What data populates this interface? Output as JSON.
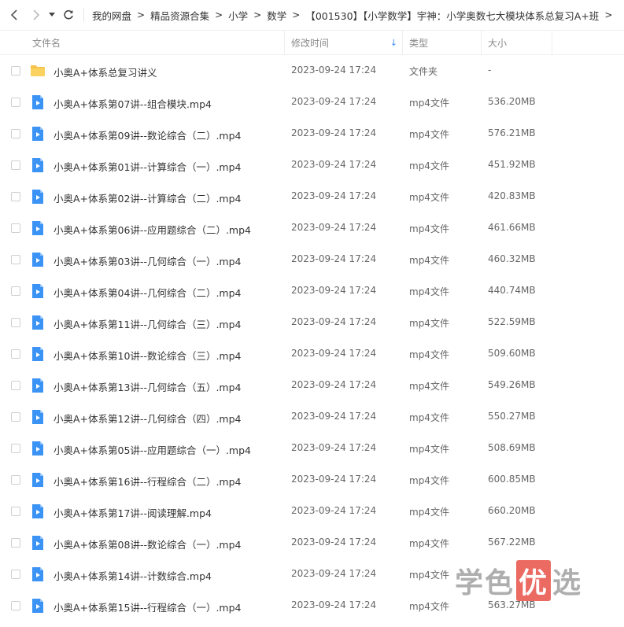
{
  "nav": {
    "breadcrumb": [
      "我的网盘",
      "精品资源合集",
      "小学",
      "数学",
      "【001530】【小学数学】宇神：小学奥数七大模块体系总复习A+班"
    ],
    "separator": ">"
  },
  "columns": {
    "name": "文件名",
    "mtime": "修改时间",
    "type": "类型",
    "size": "大小",
    "sort_indicator": "↓"
  },
  "files": [
    {
      "name": "小奥A+体系总复习讲义",
      "time": "2023-09-24 17:24",
      "type": "文件夹",
      "size": "-",
      "icon": "folder-icon"
    },
    {
      "name": "小奥A+体系第07讲--组合模块.mp4",
      "time": "2023-09-24 17:24",
      "type": "mp4文件",
      "size": "536.20MB",
      "icon": "video-file-icon"
    },
    {
      "name": "小奥A+体系第09讲--数论综合（二）.mp4",
      "time": "2023-09-24 17:24",
      "type": "mp4文件",
      "size": "576.21MB",
      "icon": "video-file-icon"
    },
    {
      "name": "小奥A+体系第01讲--计算综合（一）.mp4",
      "time": "2023-09-24 17:24",
      "type": "mp4文件",
      "size": "451.92MB",
      "icon": "video-file-icon"
    },
    {
      "name": "小奥A+体系第02讲--计算综合（二）.mp4",
      "time": "2023-09-24 17:24",
      "type": "mp4文件",
      "size": "420.83MB",
      "icon": "video-file-icon"
    },
    {
      "name": "小奥A+体系第06讲--应用题综合（二）.mp4",
      "time": "2023-09-24 17:24",
      "type": "mp4文件",
      "size": "461.66MB",
      "icon": "video-file-icon"
    },
    {
      "name": "小奥A+体系第03讲--几何综合（一）.mp4",
      "time": "2023-09-24 17:24",
      "type": "mp4文件",
      "size": "460.32MB",
      "icon": "video-file-icon"
    },
    {
      "name": "小奥A+体系第04讲--几何综合（二）.mp4",
      "time": "2023-09-24 17:24",
      "type": "mp4文件",
      "size": "440.74MB",
      "icon": "video-file-icon"
    },
    {
      "name": "小奥A+体系第11讲--几何综合（三）.mp4",
      "time": "2023-09-24 17:24",
      "type": "mp4文件",
      "size": "522.59MB",
      "icon": "video-file-icon"
    },
    {
      "name": "小奥A+体系第10讲--数论综合（三）.mp4",
      "time": "2023-09-24 17:24",
      "type": "mp4文件",
      "size": "509.60MB",
      "icon": "video-file-icon"
    },
    {
      "name": "小奥A+体系第13讲--几何综合（五）.mp4",
      "time": "2023-09-24 17:24",
      "type": "mp4文件",
      "size": "549.26MB",
      "icon": "video-file-icon"
    },
    {
      "name": "小奥A+体系第12讲--几何综合（四）.mp4",
      "time": "2023-09-24 17:24",
      "type": "mp4文件",
      "size": "550.27MB",
      "icon": "video-file-icon"
    },
    {
      "name": "小奥A+体系第05讲--应用题综合（一）.mp4",
      "time": "2023-09-24 17:24",
      "type": "mp4文件",
      "size": "508.69MB",
      "icon": "video-file-icon"
    },
    {
      "name": "小奥A+体系第16讲--行程综合（二）.mp4",
      "time": "2023-09-24 17:24",
      "type": "mp4文件",
      "size": "600.85MB",
      "icon": "video-file-icon"
    },
    {
      "name": "小奥A+体系第17讲--阅读理解.mp4",
      "time": "2023-09-24 17:24",
      "type": "mp4文件",
      "size": "660.20MB",
      "icon": "video-file-icon"
    },
    {
      "name": "小奥A+体系第08讲--数论综合（一）.mp4",
      "time": "2023-09-24 17:24",
      "type": "mp4文件",
      "size": "567.22MB",
      "icon": "video-file-icon"
    },
    {
      "name": "小奥A+体系第14讲--计数综合.mp4",
      "time": "2023-09-24 17:24",
      "type": "mp4文件",
      "size": "",
      "icon": "video-file-icon"
    },
    {
      "name": "小奥A+体系第15讲--行程综合（一）.mp4",
      "time": "2023-09-24 17:24",
      "type": "mp4文件",
      "size": "563.27MB",
      "icon": "video-file-icon"
    }
  ],
  "watermark": {
    "pre": "学色",
    "box": "优",
    "post": "选"
  },
  "colors": {
    "accent": "#3b8cff",
    "folder": "#f7c24a",
    "video": "#3a93f5"
  }
}
